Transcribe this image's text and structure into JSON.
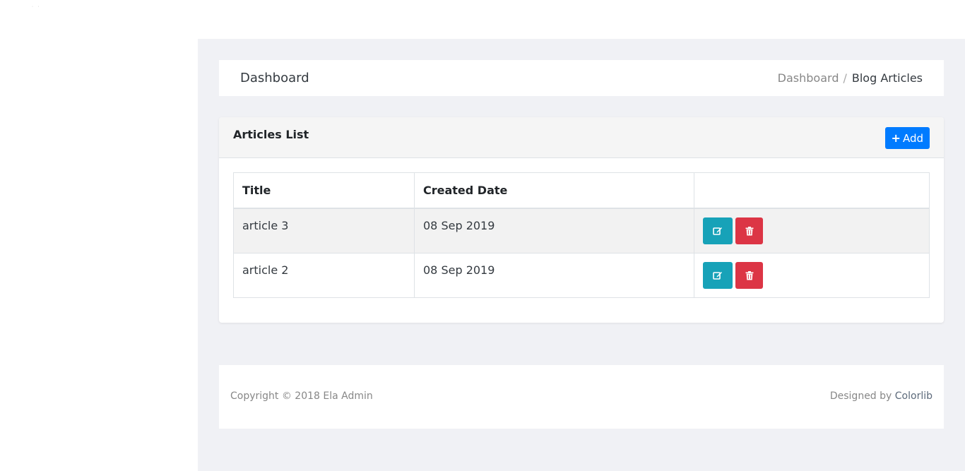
{
  "logo": {
    "dots": "˙ ˙"
  },
  "header": {
    "title": "Dashboard",
    "breadcrumb": {
      "link": "Dashboard",
      "separator": "/",
      "active": "Blog Articles"
    }
  },
  "card": {
    "title": "Articles List",
    "add_button": {
      "icon": "plus-icon",
      "label": "Add"
    },
    "columns": [
      "Title",
      "Created Date",
      ""
    ],
    "rows": [
      {
        "title": "article 3",
        "created": "08 Sep 2019"
      },
      {
        "title": "article 2",
        "created": "08 Sep 2019"
      }
    ],
    "row_actions": {
      "edit_icon": "edit-icon",
      "delete_icon": "trash-icon"
    }
  },
  "footer": {
    "copyright": "Copyright © 2018 Ela Admin",
    "designed_prefix": "Designed by",
    "designed_link": "Colorlib"
  },
  "colors": {
    "primary": "#007bff",
    "info": "#17a2b8",
    "danger": "#dc3545",
    "content_bg": "#f0f1f5"
  }
}
